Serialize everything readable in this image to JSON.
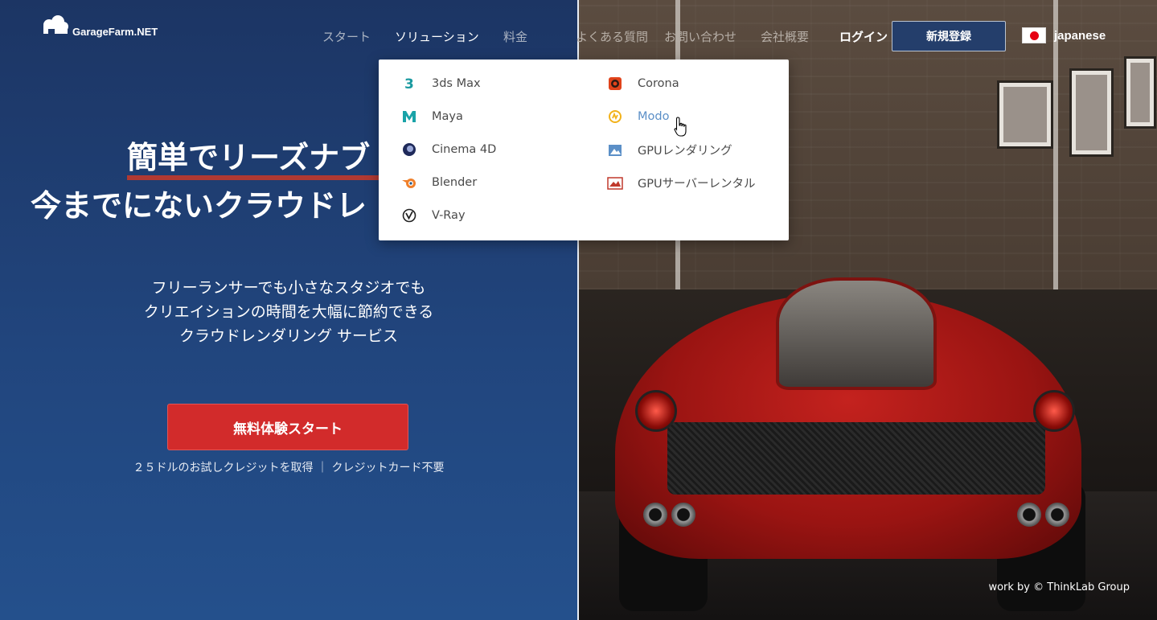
{
  "brand": {
    "name": "GarageFarm.NET"
  },
  "nav": {
    "items": [
      {
        "label": "スタート"
      },
      {
        "label": "ソリューション",
        "active": true
      },
      {
        "label": "料金"
      },
      {
        "label": "よくある質問"
      },
      {
        "label": "お問い合わせ"
      },
      {
        "label": "会社概要"
      }
    ],
    "login": "ログイン",
    "signup": "新規登録",
    "language": "japanese"
  },
  "hero": {
    "headline_line1": "簡単でリーズナブ",
    "headline_line2": "今までにないクラウドレ",
    "subtitle_lines": [
      "フリーランサーでも小さなスタジオでも",
      "クリエイションの時間を大幅に節約できる",
      "クラウドレンダリング サービス"
    ],
    "cta": "無料体験スタート",
    "note": "２５ドルのお試しクレジットを取得 ｜ クレジットカード不要"
  },
  "dropdown": {
    "left": [
      {
        "label": "3ds Max",
        "icon": "3dsmax-icon"
      },
      {
        "label": "Maya",
        "icon": "maya-icon"
      },
      {
        "label": "Cinema 4D",
        "icon": "cinema4d-icon"
      },
      {
        "label": "Blender",
        "icon": "blender-icon"
      },
      {
        "label": "V-Ray",
        "icon": "vray-icon"
      }
    ],
    "right": [
      {
        "label": "Corona",
        "icon": "corona-icon"
      },
      {
        "label": "Modo",
        "icon": "modo-icon",
        "hover": true
      },
      {
        "label": "GPUレンダリング",
        "icon": "gpu-rendering-icon"
      },
      {
        "label": "GPUサーバーレンタル",
        "icon": "gpu-server-icon"
      }
    ]
  },
  "photo_credit": "work by © ThinkLab Group",
  "colors": {
    "accent_red": "#d22b2b",
    "navy": "#1c3564",
    "link_hover": "#5b8fc7"
  }
}
